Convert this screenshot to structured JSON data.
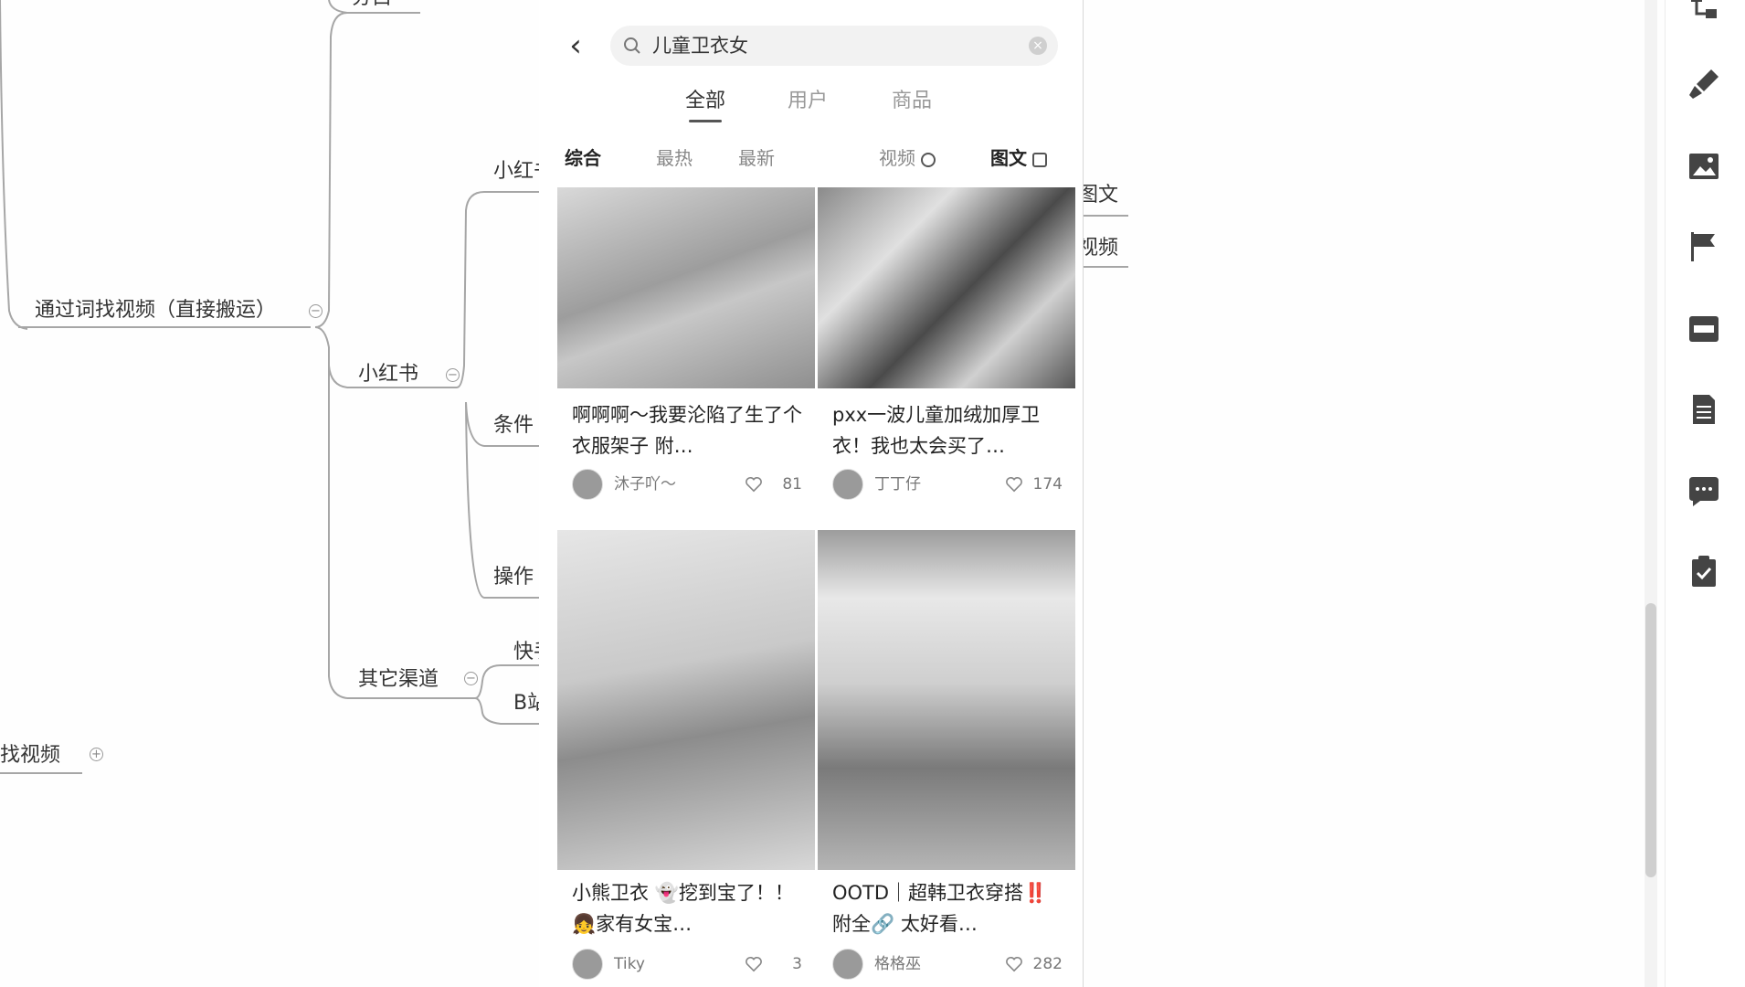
{
  "mindmap": {
    "node_top_partial": "分白",
    "node_find_by_words": "通过词找视频（直接搬运）",
    "node_xiaohongshu": "小红书",
    "node_xiaohongshu_child": "小红书",
    "node_conditions": "条件",
    "node_operation": "操作",
    "node_other_channels": "其它渠道",
    "node_kuaishou": "快手",
    "node_bilibili": "B站",
    "node_find_video_partial": "找视频",
    "node_image_text": "图文",
    "node_video": "视频",
    "toggle_collapse": "−",
    "toggle_expand": "+"
  },
  "phone": {
    "search": {
      "query": "儿童卫衣女"
    },
    "tabs": [
      {
        "label": "全部",
        "active": true
      },
      {
        "label": "用户",
        "active": false
      },
      {
        "label": "商品",
        "active": false
      }
    ],
    "filters": {
      "comprehensive": "综合",
      "hottest": "最热",
      "newest": "最新",
      "video": "视频",
      "image_text": "图文"
    },
    "cards": [
      {
        "title": "啊啊啊～我要沦陷了生了个衣服架子 附…",
        "author": "沐子吖～",
        "likes": "81"
      },
      {
        "title": "pxx一波儿童加绒加厚卫衣！我也太会买了…",
        "author": "丁丁仔",
        "likes": "174"
      },
      {
        "title": "小熊卫衣 👻挖到宝了！！👧家有女宝…",
        "author": "Tiky",
        "likes": "3"
      },
      {
        "title": "OOTD｜超韩卫衣穿搭‼️附全🔗 太好看…",
        "author": "格格巫",
        "likes": "282"
      }
    ]
  },
  "colors": {
    "accent": "#333333",
    "line": "#a6a6a6",
    "image_placeholder": "#bdbdbd"
  },
  "toolbar": {
    "icons": [
      "structure-icon",
      "brush-icon",
      "image-icon",
      "flag-icon",
      "formula-icon",
      "note-icon",
      "comment-icon",
      "task-icon"
    ]
  }
}
